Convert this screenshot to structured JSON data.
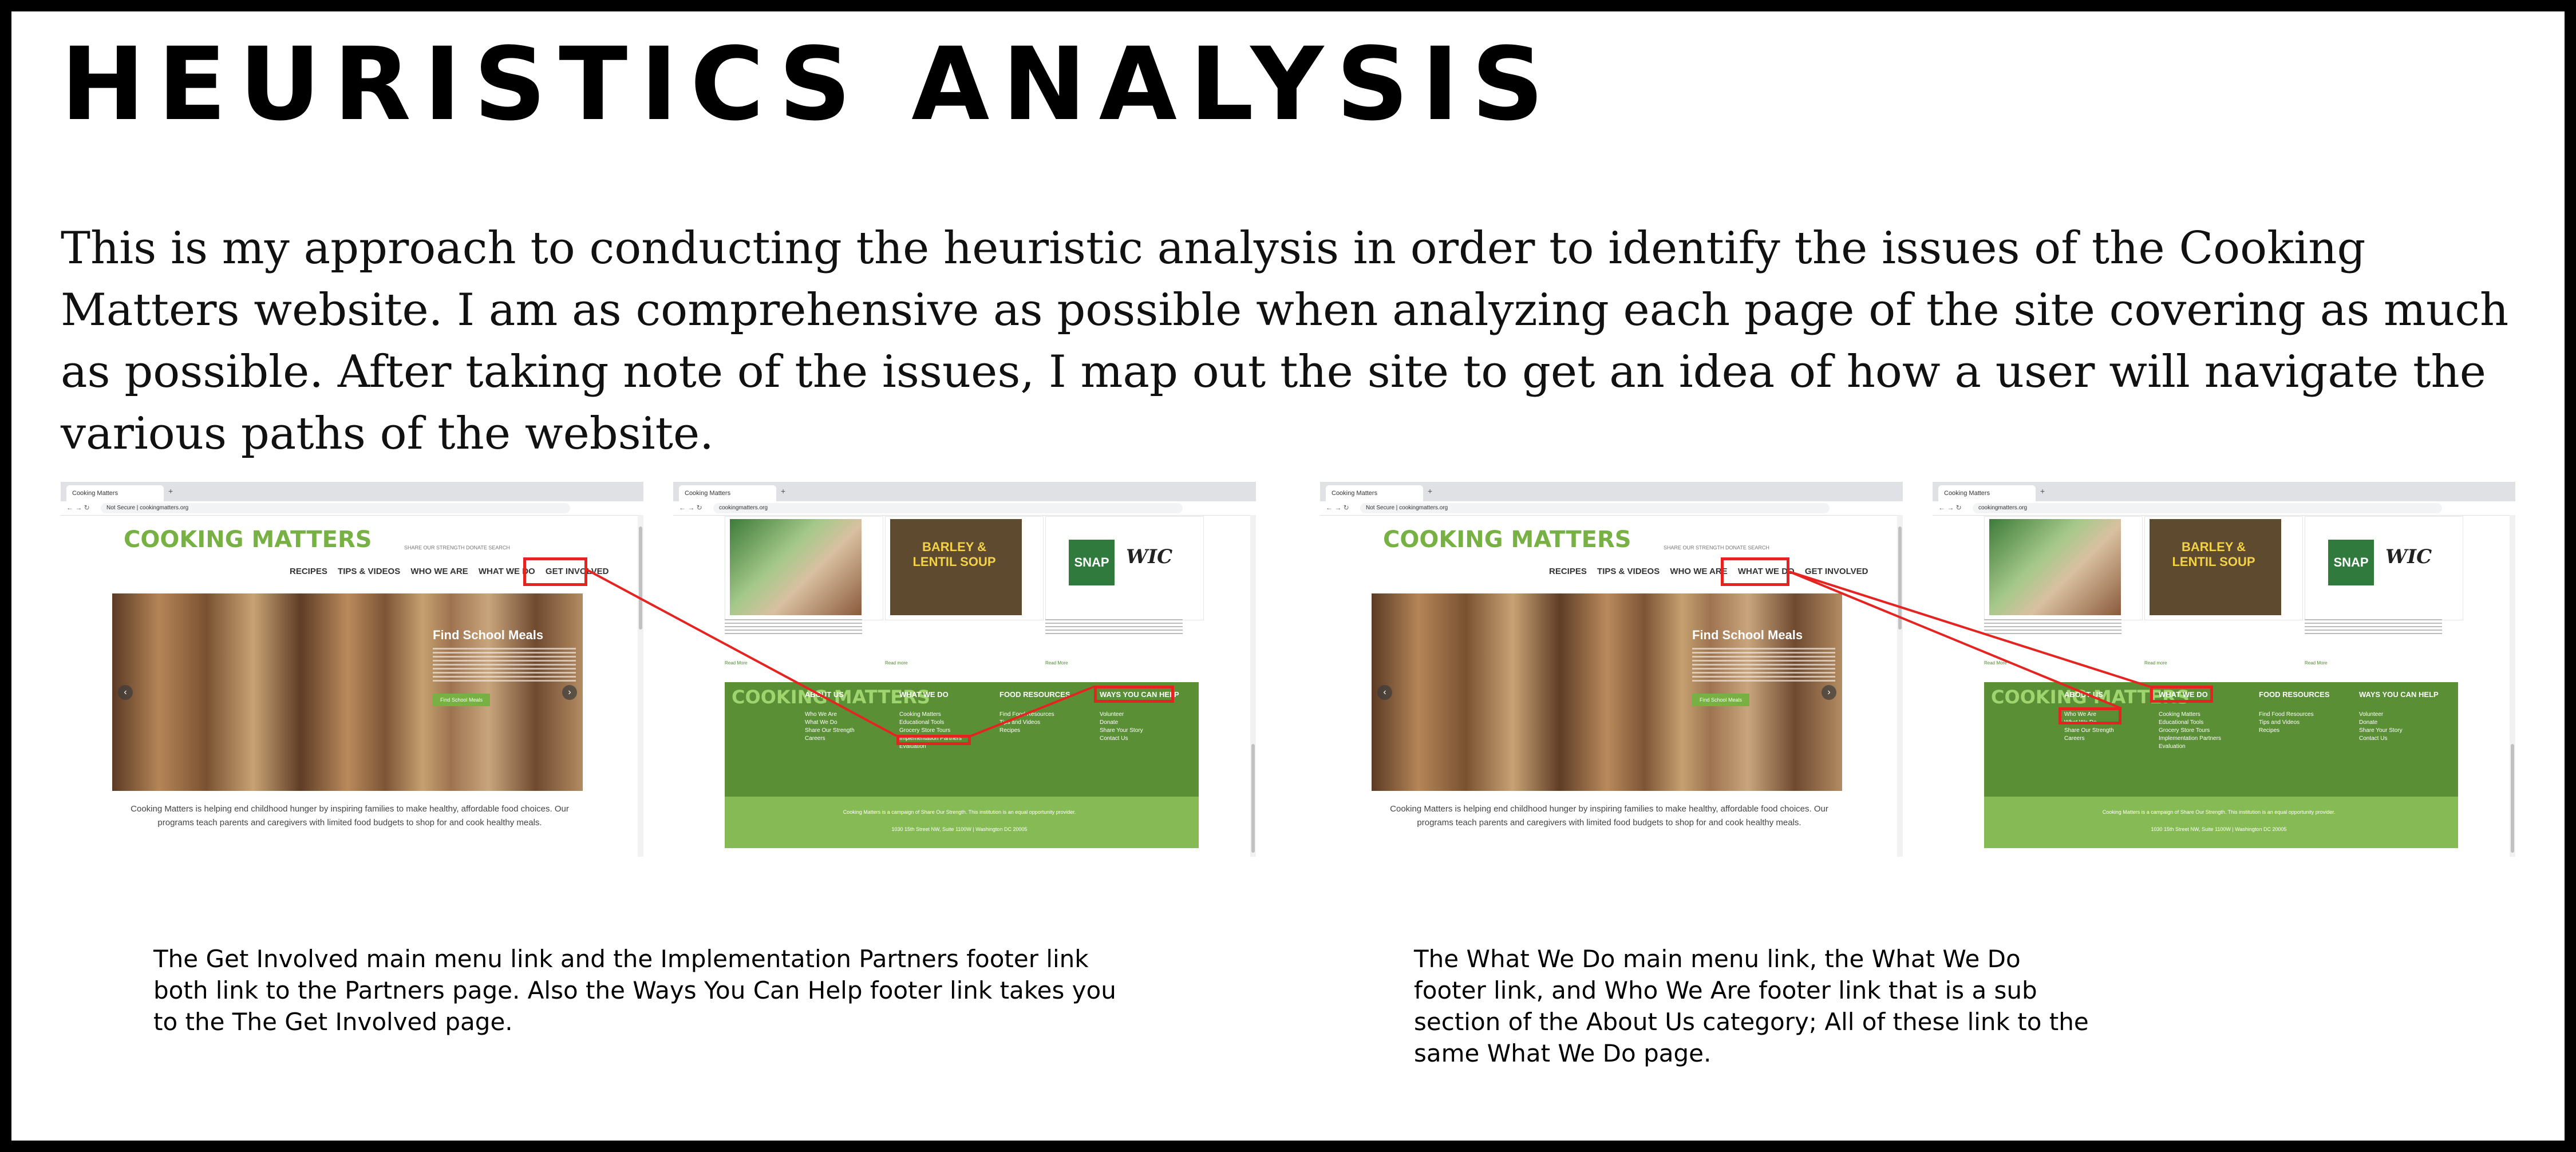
{
  "title": "HEURISTICS ANALYSIS",
  "intro": "This is my approach to conducting the heuristic analysis in order  to identify the issues of the Cooking Matters website.  I am as comprehensive as possible when analyzing each page of the site covering as much as possible. After taking note of the issues, I map out the site to get an idea of how a user will navigate the various paths of the website.",
  "colors": {
    "accent_green": "#77b043",
    "footer_green": "#5a8f36",
    "footer_light": "#86ba55",
    "highlight_red": "#e52421"
  },
  "browser": {
    "tab_title": "Cooking Matters",
    "url": "cookingmatters.org",
    "url_insecure": "Not Secure  |  cookingmatters.org",
    "new_tab_icon": "plus-icon"
  },
  "site": {
    "logo": "COOKING MATTERS",
    "utility": "SHARE OUR STRENGTH  DONATE  SEARCH",
    "menu": [
      "RECIPES",
      "TIPS & VIDEOS",
      "WHO WE ARE",
      "WHAT WE DO",
      "GET INVOLVED"
    ],
    "hero_title": "Find School Meals",
    "hero_button": "Find School Meals",
    "tagline": "Cooking Matters is helping end childhood hunger by inspiring families to make healthy, affordable food choices. Our programs teach parents and caregivers with limited food budgets to shop for and cook healthy meals.",
    "card_captions": [
      "Before taking a Cooking Matters course, Nelba went to the grocery store once per week without a plan.",
      "Watch our chefs prepare over 50 recipes",
      "Eating to feed your family on a tight budget? Check out some of these resources to help you put healthy food on the table."
    ],
    "card_links": [
      "Read More",
      "Read more",
      "Read More"
    ],
    "card_badges": [
      "BARLEY & LENTIL SOUP",
      "SNAP",
      "WIC"
    ],
    "footer_logo": "COOKING MATTERS",
    "footer_columns": [
      {
        "title": "ABOUT US",
        "items": [
          "Who We Are",
          "What We Do",
          "Share Our Strength",
          "Careers"
        ]
      },
      {
        "title": "WHAT WE DO",
        "items": [
          "Cooking Matters",
          "Educational Tools",
          "Grocery Store Tours",
          "Implementation Partners",
          "Evaluation"
        ]
      },
      {
        "title": "FOOD RESOURCES",
        "items": [
          "Find Food Resources",
          "Tips and Videos",
          "Recipes"
        ]
      },
      {
        "title": "WAYS YOU CAN HELP",
        "items": [
          "Volunteer",
          "Donate",
          "Share Your Story",
          "Contact Us"
        ]
      }
    ],
    "footer_copy": "Cooking Matters is a campaign of Share Our Strength. This institution is an equal opportunity provider.",
    "footer_address": "1030 15th Street NW, Suite 1100W | Washington DC 20005"
  },
  "notes": [
    "The Get Involved main menu link and the Implementation Partners footer link both link to the Partners page. Also the Ways You Can Help footer link takes you to the The Get Involved page.",
    "The What We Do main menu link, the What We Do footer link, and Who We Are footer link that is a sub section of the About Us category; All of these link to the same What We Do page."
  ]
}
